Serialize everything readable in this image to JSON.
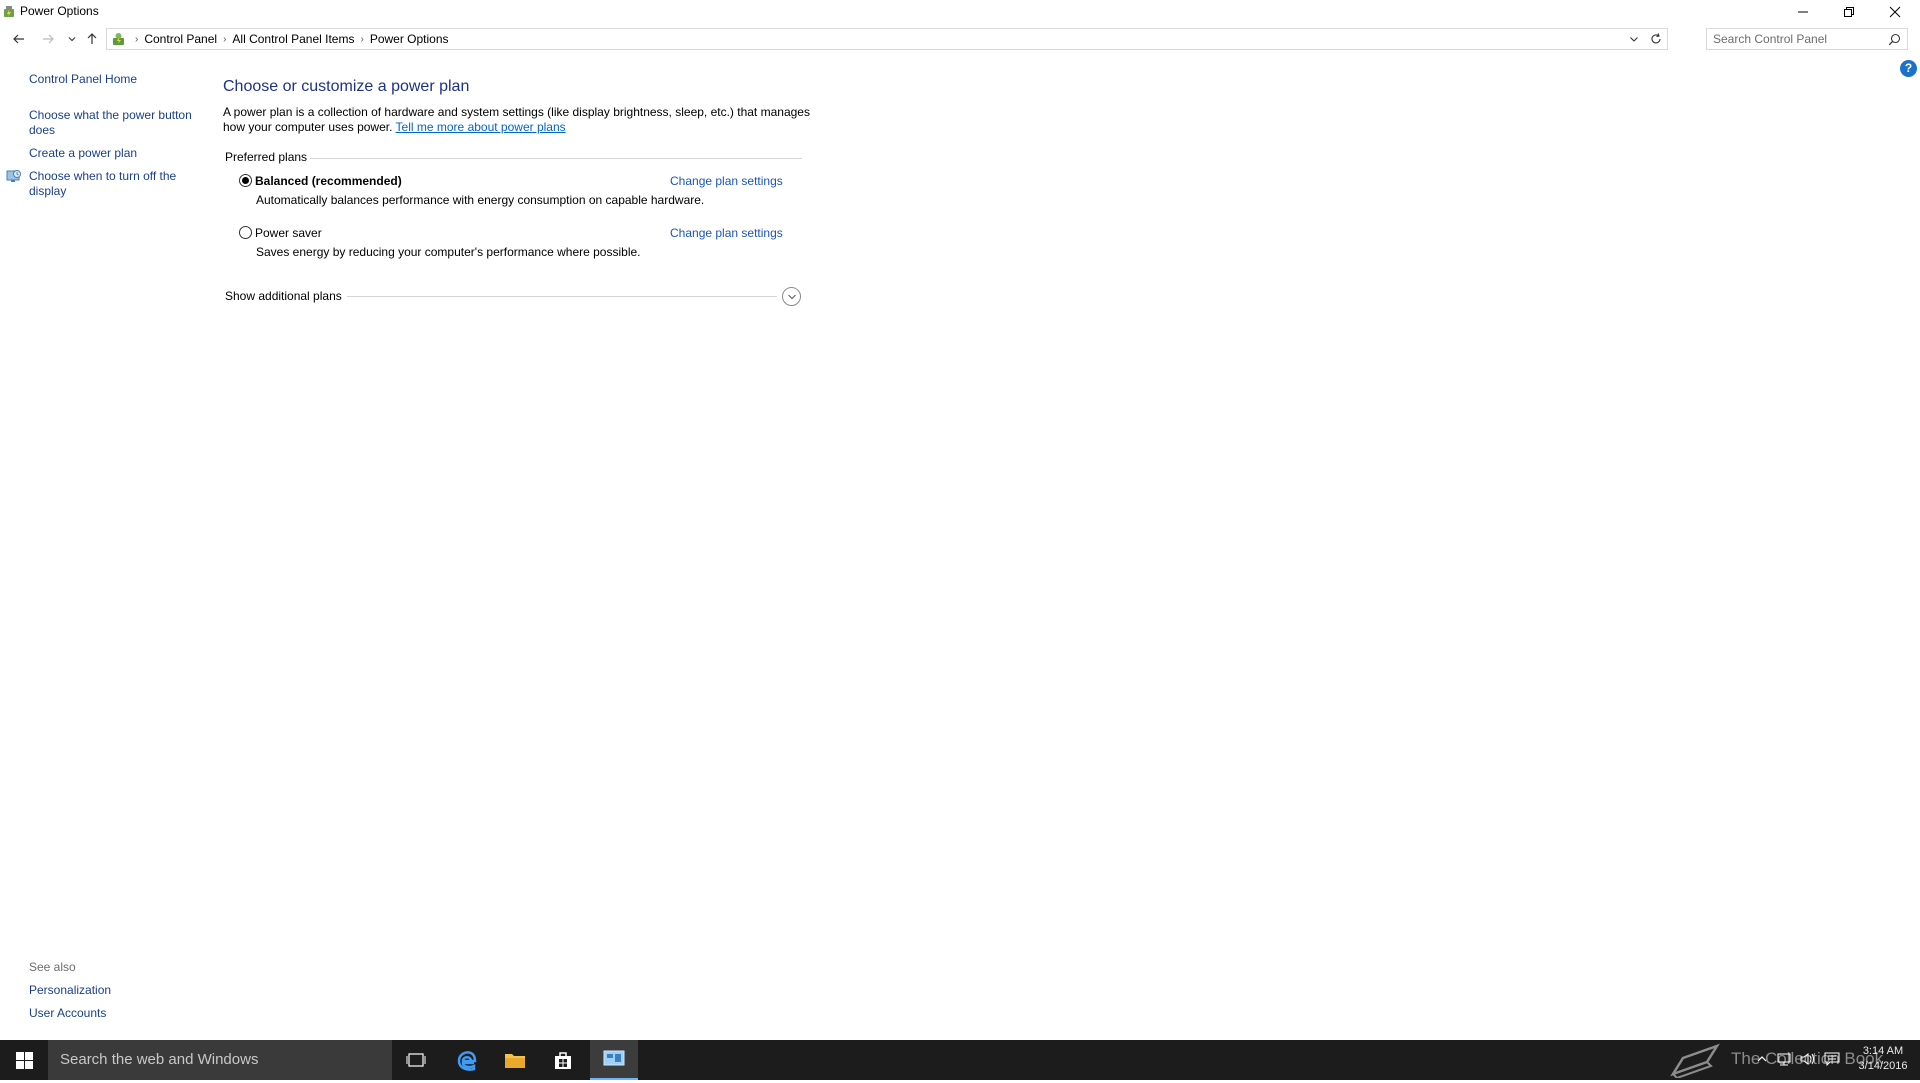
{
  "window": {
    "title": "Power Options"
  },
  "address_bar": {
    "breadcrumbs": [
      "Control Panel",
      "All Control Panel Items",
      "Power Options"
    ],
    "search_placeholder": "Search Control Panel"
  },
  "left_pane": {
    "home_link": "Control Panel Home",
    "links": [
      "Choose what the power button does",
      "Create a power plan",
      "Choose when to turn off the display"
    ],
    "see_also_label": "See also",
    "see_also_links": [
      "Personalization",
      "User Accounts"
    ]
  },
  "main": {
    "title": "Choose or customize a power plan",
    "description": "A power plan is a collection of hardware and system settings (like display brightness, sleep, etc.) that manages how your computer uses power.",
    "more_link": "Tell me more about power plans",
    "group_label": "Preferred plans",
    "plans": [
      {
        "name": "Balanced (recommended)",
        "description": "Automatically balances performance with energy consumption on capable hardware.",
        "link": "Change plan settings",
        "selected": true
      },
      {
        "name": "Power saver",
        "description": "Saves energy by reducing your computer's performance where possible.",
        "link": "Change plan settings",
        "selected": false
      }
    ],
    "additional_plans_label": "Show additional plans"
  },
  "taskbar": {
    "search_text": "Search the web and Windows",
    "watermark": "The Collection Book",
    "time": "3:14 AM",
    "date": "3/14/2016"
  },
  "colors": {
    "link": "#1a3f8c",
    "title": "#1e3287",
    "taskbar": "#1c1c1c",
    "help": "#1a73c8"
  }
}
